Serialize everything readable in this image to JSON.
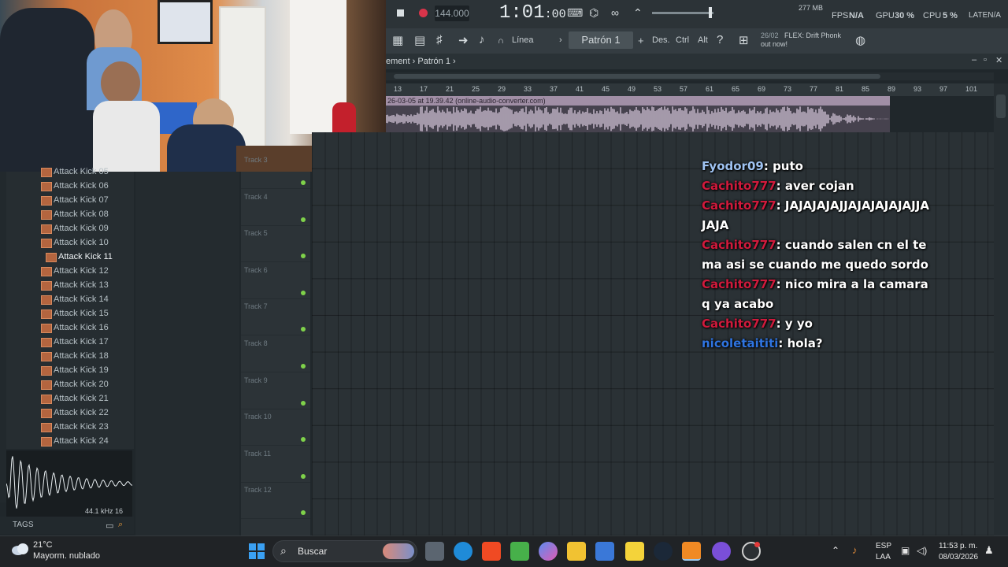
{
  "topbar": {
    "tempo": "144.000",
    "time_main": "1:01",
    "time_sub": ":00",
    "fps_label": "FPS",
    "fps_value": "N/A",
    "memory": "277 MB",
    "gpu_label": "GPU",
    "gpu_value": "30 %",
    "cpu_label": "CPU",
    "cpu_value": "5 %",
    "latency": "LATEN/A"
  },
  "toolbar2": {
    "line_label": "Línea",
    "pattern": "Patrón 1",
    "des_label": "Des.",
    "ctrl_label": "Ctrl",
    "alt_label": "Alt",
    "news_date": "26/02",
    "news_line1": "FLEX: Drift Phonk",
    "news_line2": "out now!"
  },
  "breadcrumb": {
    "section": "ement",
    "pattern": "Patrón 1"
  },
  "ruler": [
    "13",
    "17",
    "21",
    "25",
    "29",
    "33",
    "37",
    "41",
    "45",
    "49",
    "53",
    "57",
    "61",
    "65",
    "69",
    "73",
    "77",
    "81",
    "85",
    "89",
    "93",
    "97",
    "101"
  ],
  "clip": {
    "title": "26-03-05 at 19.39.42 (online-audio-converter.com)"
  },
  "browser": {
    "items": [
      "Attack Kick 05",
      "Attack Kick 06",
      "Attack Kick 07",
      "Attack Kick 08",
      "Attack Kick 09",
      "Attack Kick 10",
      "Attack Kick 11",
      "Attack Kick 12",
      "Attack Kick 13",
      "Attack Kick 14",
      "Attack Kick 15",
      "Attack Kick 16",
      "Attack Kick 17",
      "Attack Kick 18",
      "Attack Kick 19",
      "Attack Kick 20",
      "Attack Kick 21",
      "Attack Kick 22",
      "Attack Kick 23",
      "Attack Kick 24"
    ],
    "selected": "Attack Kick 11",
    "preview_info": "44.1 kHz 16",
    "tags_label": "TAGS"
  },
  "tracks": [
    "Track 3",
    "Track 4",
    "Track 5",
    "Track 6",
    "Track 7",
    "Track 8",
    "Track 9",
    "Track 10",
    "Track 11",
    "Track 12"
  ],
  "chat": [
    {
      "user": "Fyodor09",
      "color": "#9fc3f2",
      "message": "puto"
    },
    {
      "user": "Cachito777",
      "color": "#d01a3c",
      "message": "aver cojan"
    },
    {
      "user": "Cachito777",
      "color": "#d01a3c",
      "message": "JAJAJAJAJJAJAJAJAJAJJAJAJA"
    },
    {
      "user": "Cachito777",
      "color": "#d01a3c",
      "message": "cuando salen cn el tema asi se cuando me quedo sordo"
    },
    {
      "user": "Cachito777",
      "color": "#d01a3c",
      "message": "nico mira a la camara q ya acabo"
    },
    {
      "user": "Cachito777",
      "color": "#d01a3c",
      "message": "y yo"
    },
    {
      "user": "nicoletaititi",
      "color": "#2f74e0",
      "message": "hola?"
    }
  ],
  "taskbar": {
    "temperature": "21°C",
    "weather": "Mayorm. nublado",
    "search_placeholder": "Buscar",
    "language": "ESP",
    "layout": "LAA",
    "time": "11:53 p. m.",
    "date": "08/03/2026"
  },
  "colors": {
    "accent_green": "#7fd24a",
    "record_red": "#d9344a",
    "clip_purple": "#a18fa6",
    "browser_folder": "#b4653f"
  }
}
